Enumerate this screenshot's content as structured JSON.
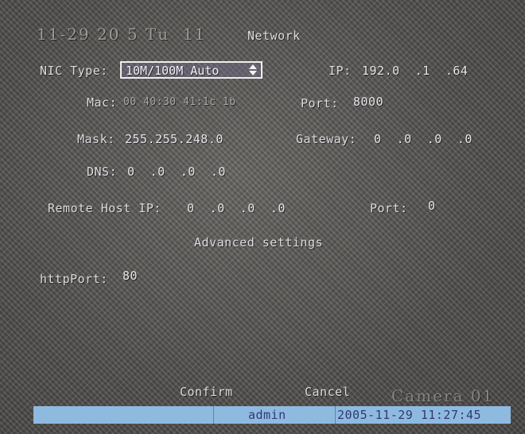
{
  "overlay": {
    "datetime_ghost": "11-29 20 5 Tu  11",
    "camera_ghost": "Camera 01"
  },
  "window": {
    "title": "Network"
  },
  "fields": {
    "nic_type": {
      "label": "NIC Type:",
      "value": "10M/100M Auto"
    },
    "ip": {
      "label": "IP:",
      "value": "192.0  .1  .64"
    },
    "mac": {
      "label": "Mac:",
      "value": "00 40:30 41:1c 1b"
    },
    "port": {
      "label": "Port:",
      "value": "8000"
    },
    "mask": {
      "label": "Mask:",
      "value": "255.255.248.0"
    },
    "gateway": {
      "label": "Gateway:",
      "value": "0  .0  .0  .0"
    },
    "dns": {
      "label": "DNS:",
      "value": "0  .0  .0  .0"
    },
    "remote_host_ip": {
      "label": "Remote Host IP:",
      "value": "0  .0  .0  .0"
    },
    "remote_port": {
      "label": "Port:",
      "value": "0"
    },
    "advanced_settings": "Advanced settings",
    "http_port": {
      "label": "httpPort:",
      "value": "80"
    }
  },
  "buttons": {
    "confirm": "Confirm",
    "cancel": "Cancel"
  },
  "status_bar": {
    "user": "admin",
    "datetime": "2005-11-29 11:27:45"
  },
  "colors": {
    "status_bar_bg": "#8fbadf",
    "status_bar_text": "#2f3a74",
    "screen_bg": "#585654",
    "text": "#dedbe0"
  }
}
